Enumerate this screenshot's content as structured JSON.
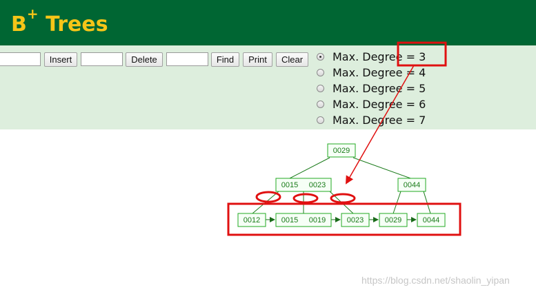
{
  "header": {
    "title": "B",
    "title_sup": "+",
    "title_rest": " Trees",
    "bg_color": "#006633",
    "title_color": "#f5c518"
  },
  "toolbar": {
    "insert_value": "",
    "insert_label": "Insert",
    "delete_value": "",
    "delete_label": "Delete",
    "find_value": "",
    "find_label": "Find",
    "print_label": "Print",
    "clear_label": "Clear"
  },
  "degree_options": [
    {
      "label": "Max. Degree = 3",
      "selected": true
    },
    {
      "label": "Max. Degree = 4",
      "selected": false
    },
    {
      "label": "Max. Degree = 5",
      "selected": false
    },
    {
      "label": "Max. Degree = 6",
      "selected": false
    },
    {
      "label": "Max. Degree = 7",
      "selected": false
    }
  ],
  "tree": {
    "root": [
      "0029"
    ],
    "internal_left": [
      "0015",
      "0023"
    ],
    "internal_right": [
      "0044"
    ],
    "leaves": [
      [
        "0012"
      ],
      [
        "0015",
        "0019"
      ],
      [
        "0023"
      ],
      [
        "0029"
      ],
      [
        "0044"
      ]
    ],
    "node_color": "#1a8a1a",
    "annotation_color": "#e01010"
  },
  "watermark": "https://blog.csdn.net/shaolin_yipan"
}
